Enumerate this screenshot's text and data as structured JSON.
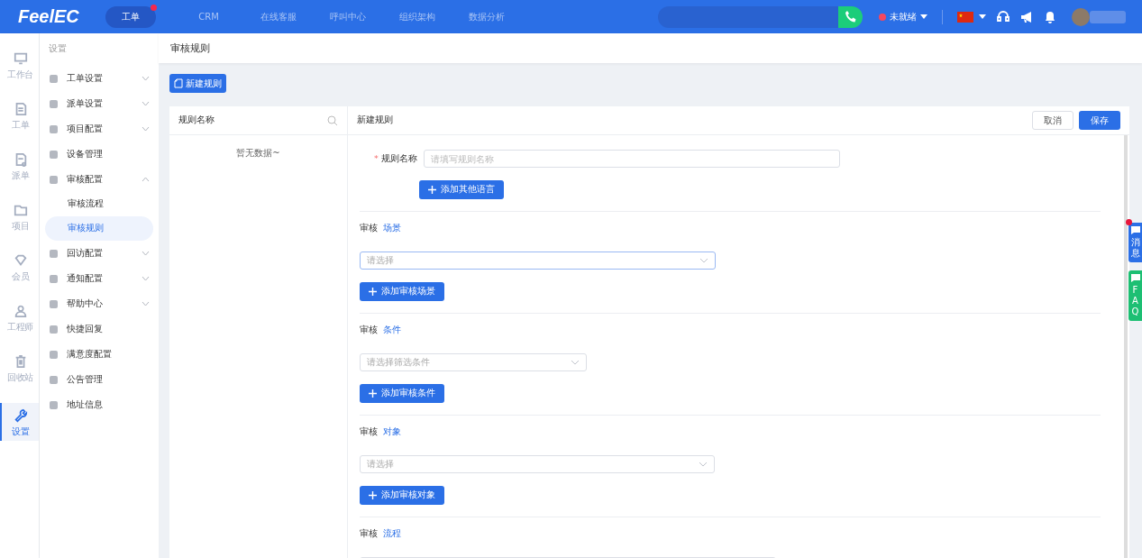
{
  "header": {
    "logo": "FeelEC",
    "nav": [
      {
        "label": "工单",
        "selected": true,
        "badge": true
      },
      {
        "label": "CRM",
        "selected": false,
        "badge": false
      },
      {
        "label": "在线客服",
        "selected": false,
        "badge": false
      },
      {
        "label": "呼叫中心",
        "selected": false,
        "badge": false
      },
      {
        "label": "组织架构",
        "selected": false,
        "badge": false
      },
      {
        "label": "数据分析",
        "selected": false,
        "badge": false
      }
    ],
    "status": {
      "label": "未就绪",
      "color": "#f5475e"
    }
  },
  "rail": [
    {
      "label": "工作台",
      "selected": false
    },
    {
      "label": "工单",
      "selected": false
    },
    {
      "label": "派单",
      "selected": false
    },
    {
      "label": "项目",
      "selected": false
    },
    {
      "label": "会员",
      "selected": false
    },
    {
      "label": "工程师",
      "selected": false
    },
    {
      "label": "回收站",
      "selected": false
    },
    {
      "label": "设置",
      "selected": true
    }
  ],
  "menu": {
    "title": "设置",
    "items": [
      {
        "label": "工单设置",
        "expandable": true,
        "expanded": false
      },
      {
        "label": "派单设置",
        "expandable": true,
        "expanded": false
      },
      {
        "label": "项目配置",
        "expandable": true,
        "expanded": false
      },
      {
        "label": "设备管理",
        "expandable": false
      },
      {
        "label": "审核配置",
        "expandable": true,
        "expanded": true,
        "children": [
          {
            "label": "审核流程",
            "selected": false
          },
          {
            "label": "审核规则",
            "selected": true
          }
        ]
      },
      {
        "label": "回访配置",
        "expandable": true,
        "expanded": false
      },
      {
        "label": "通知配置",
        "expandable": true,
        "expanded": false
      },
      {
        "label": "帮助中心",
        "expandable": true,
        "expanded": false
      },
      {
        "label": "快捷回复",
        "expandable": false
      },
      {
        "label": "满意度配置",
        "expandable": false
      },
      {
        "label": "公告管理",
        "expandable": false
      },
      {
        "label": "地址信息",
        "expandable": false
      }
    ]
  },
  "page_title": "审核规则",
  "new_button": "新建规则",
  "list": {
    "title": "规则名称",
    "empty": "暂无数据~"
  },
  "form": {
    "title": "新建规则",
    "cancel": "取消",
    "save": "保存",
    "name_field": {
      "label": "规则名称",
      "required_mark": "*",
      "placeholder": "请填写规则名称"
    },
    "add_language": "添加其他语言",
    "sections": [
      {
        "prefix": "审核",
        "title": "场景",
        "placeholder": "请选择",
        "focused": true,
        "button": "添加审核场景"
      },
      {
        "prefix": "审核",
        "title": "条件",
        "placeholder": "请选择筛选条件",
        "focused": false,
        "button": "添加审核条件"
      },
      {
        "prefix": "审核",
        "title": "对象",
        "placeholder": "请选择",
        "focused": false,
        "button": "添加审核对象"
      },
      {
        "prefix": "审核",
        "title": "流程",
        "focused": false
      }
    ]
  },
  "side_tabs": [
    {
      "label": "消息",
      "badge": true,
      "color": "#2b6fe6"
    },
    {
      "label": "FAQ",
      "badge": false,
      "color": "#1dbf73"
    }
  ]
}
